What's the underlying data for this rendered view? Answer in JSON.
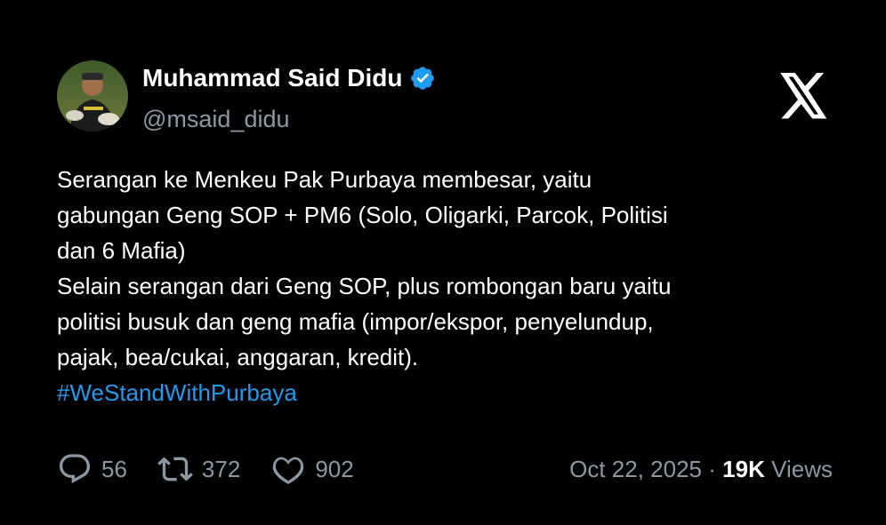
{
  "author": {
    "display_name": "Muhammad Said Didu",
    "handle": "@msaid_didu",
    "verified": true,
    "avatar_icon": "profile-photo"
  },
  "brand": {
    "logo_icon": "x-logo"
  },
  "tweet": {
    "lines": [
      "Serangan ke Menkeu Pak Purbaya membesar, yaitu",
      "gabungan Geng SOP + PM6 (Solo, Oligarki, Parcok, Politisi",
      "dan 6 Mafia)",
      "Selain serangan dari Geng SOP, plus rombongan baru yaitu",
      "politisi busuk dan geng mafia (impor/ekspor, penyelundup,",
      "pajak, bea/cukai, anggaran, kredit)."
    ],
    "hashtag": "#WeStandWithPurbaya"
  },
  "metrics": {
    "replies": "56",
    "reposts": "372",
    "likes": "902"
  },
  "meta": {
    "date": "Oct 22, 2025",
    "separator": "·",
    "views_count": "19K",
    "views_label": "Views"
  },
  "colors": {
    "background": "#000000",
    "text": "#ffffff",
    "secondary": "#8b98a5",
    "link": "#1d9bf0",
    "verified": "#1d9bf0"
  }
}
